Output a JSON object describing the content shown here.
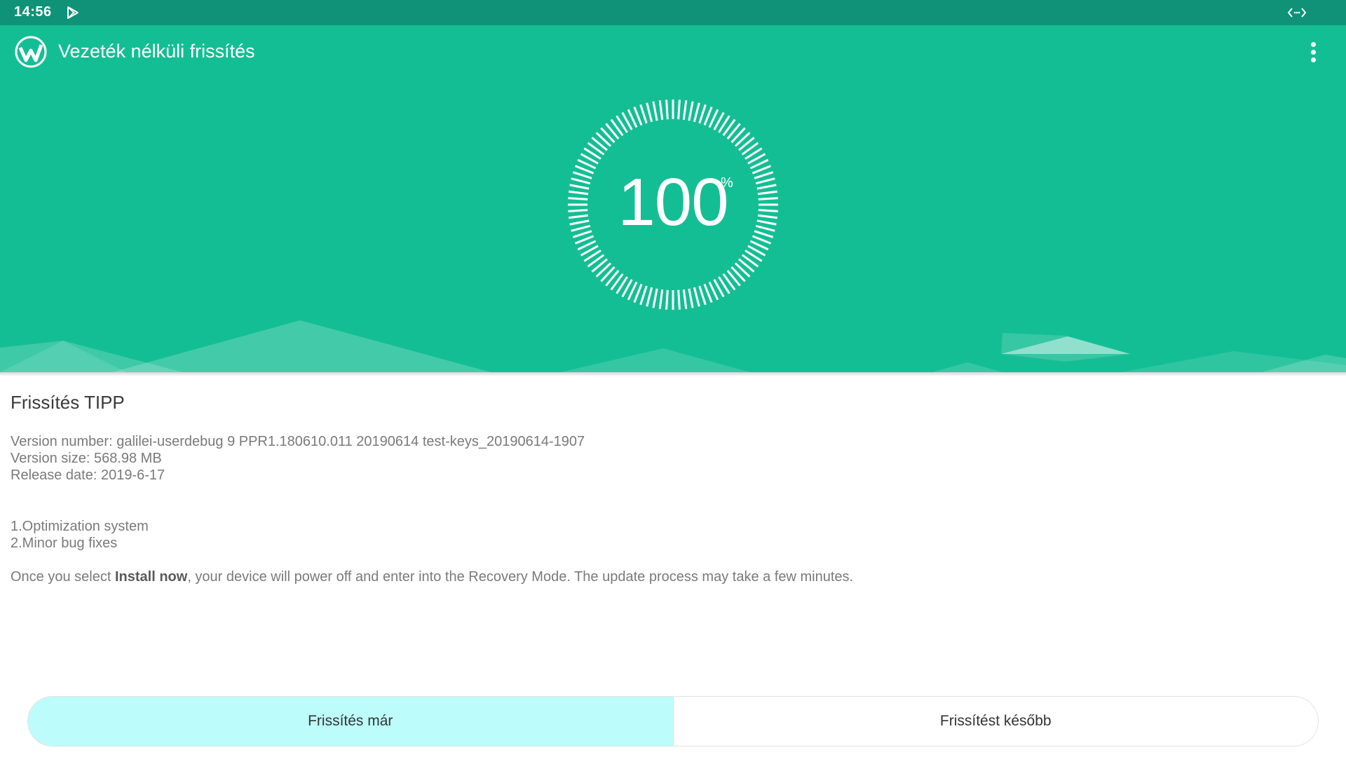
{
  "status_bar": {
    "time": "14:56",
    "icons": [
      "play-store-icon",
      "code-brackets-icon"
    ]
  },
  "app": {
    "title": "Vezeték nélküli frissítés",
    "logo_icon": "app-logo-icon",
    "menu_icon": "more-vert-icon",
    "header_color": "#14be94",
    "status_bar_color": "#0f9278"
  },
  "progress": {
    "value": "100",
    "unit": "%",
    "fraction": 1.0
  },
  "tip": {
    "title": "Frissítés TIPP",
    "version_number": "Version number: galilei-userdebug 9 PPR1.180610.011 20190614 test-keys_20190614-1907",
    "version_size": "Version size: 568.98 MB",
    "release_date": "Release date: 2019-6-17",
    "changes": [
      "1.Optimization system",
      "2.Minor bug fixes"
    ],
    "note_prefix": "Once you select ",
    "note_bold": "Install now",
    "note_suffix": ", your device will power off and enter into the Recovery Mode. The update process may take a few minutes."
  },
  "buttons": {
    "install_now": "Frissítés már",
    "later": "Frissítést később",
    "install_now_color": "#bcfcfa"
  }
}
